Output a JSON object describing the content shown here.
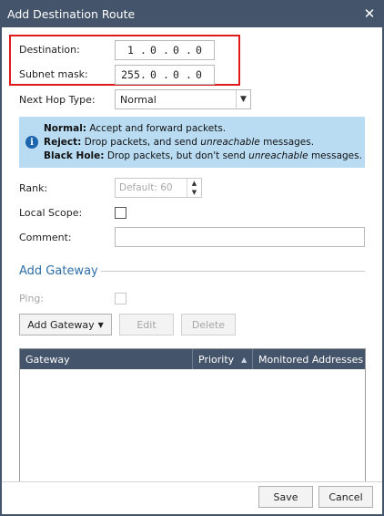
{
  "window": {
    "title": "Add Destination Route",
    "close_glyph": "✕"
  },
  "destination": {
    "label": "Destination:",
    "octets": [
      "1",
      "0",
      "0",
      "0"
    ]
  },
  "subnet_mask": {
    "label": "Subnet mask:",
    "octets": [
      "255",
      "0",
      "0",
      "0"
    ]
  },
  "next_hop": {
    "label": "Next Hop Type:",
    "value": "Normal"
  },
  "info": {
    "normal_term": "Normal:",
    "normal_text": " Accept and forward packets.",
    "reject_term": "Reject:",
    "reject_text_1": " Drop packets, and send ",
    "reject_em": "unreachable",
    "reject_text_2": " messages.",
    "blackhole_term": "Black Hole:",
    "blackhole_text_1": " Drop packets, but don't send ",
    "blackhole_em": "unreachable",
    "blackhole_text_2": " messages."
  },
  "rank": {
    "label": "Rank:",
    "placeholder": "Default: 60"
  },
  "local_scope": {
    "label": "Local Scope:",
    "checked": false
  },
  "comment": {
    "label": "Comment:",
    "value": ""
  },
  "gateway_section": {
    "title": "Add Gateway",
    "ping_label": "Ping:",
    "add_button": "Add Gateway",
    "edit_button": "Edit",
    "delete_button": "Delete",
    "columns": [
      "Gateway",
      "Priority",
      "Monitored Addresses"
    ],
    "rows": []
  },
  "footer": {
    "save": "Save",
    "cancel": "Cancel"
  },
  "colors": {
    "titlebar": "#44546a",
    "highlight": "#e0191d",
    "info_bg": "#b9dcf3",
    "section_title": "#2f6fa8"
  }
}
